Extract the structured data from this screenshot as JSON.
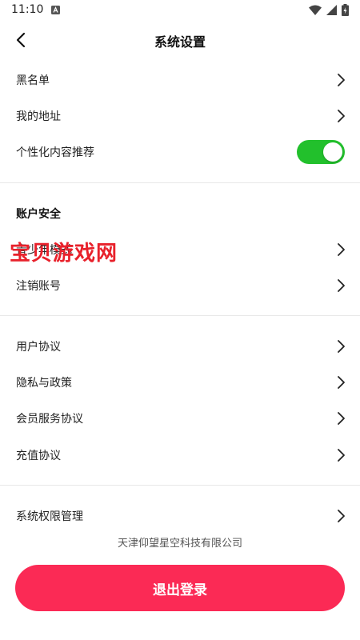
{
  "status_bar": {
    "time": "11:10"
  },
  "header": {
    "title": "系统设置"
  },
  "groups": {
    "general": [
      {
        "label": "黑名单"
      },
      {
        "label": "我的地址"
      }
    ],
    "personalized": {
      "label": "个性化内容推荐",
      "enabled": true
    },
    "account": {
      "title": "账户安全",
      "items": [
        {
          "label": "青少年模式"
        },
        {
          "label": "注销账号"
        }
      ]
    },
    "agreements": [
      {
        "label": "用户协议"
      },
      {
        "label": "隐私与政策"
      },
      {
        "label": "会员服务协议"
      },
      {
        "label": "充值协议"
      }
    ],
    "permissions": {
      "label": "系统权限管理"
    }
  },
  "watermark": "宝贝游戏网",
  "footer": {
    "company": "天津仰望星空科技有限公司",
    "logout_label": "退出登录"
  },
  "colors": {
    "toggle_on": "#22c02c",
    "logout_bg": "#fb2a55",
    "watermark": "#e8212b"
  },
  "icons": {
    "back": "arrow-left-icon",
    "chevron": "chevron-right-icon",
    "wifi": "wifi-icon",
    "signal": "signal-icon",
    "battery": "battery-icon"
  }
}
